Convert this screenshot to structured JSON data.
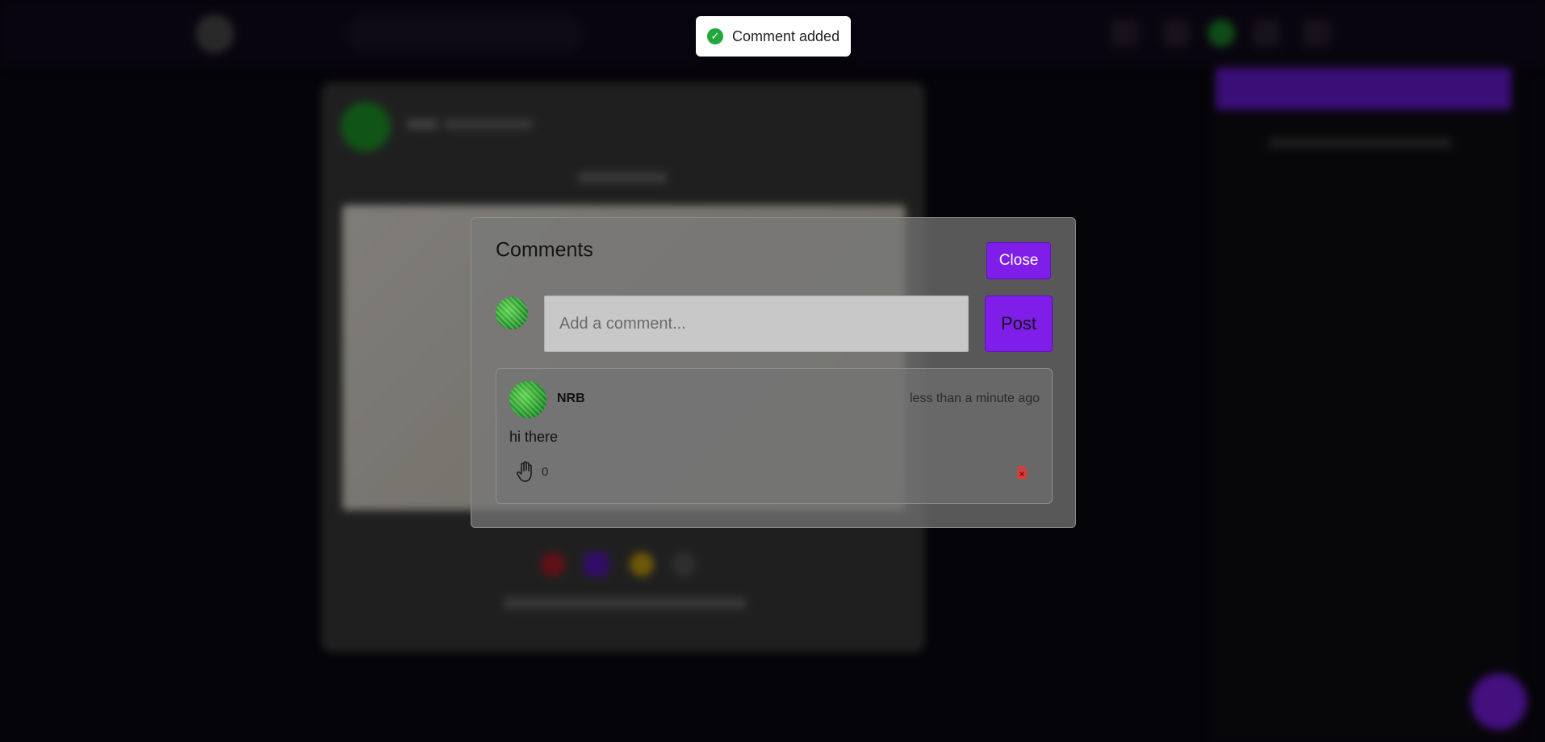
{
  "toast": {
    "icon": "check-circle-icon",
    "message": "Comment added"
  },
  "modal": {
    "title": "Comments",
    "close_label": "Close",
    "input_placeholder": "Add a comment...",
    "post_label": "Post"
  },
  "comments": [
    {
      "author": "NRB",
      "time": "less than a minute ago",
      "text": "hi there",
      "like_icon": "hand-icon",
      "likes": "0",
      "delete_icon": "trash-icon"
    }
  ],
  "colors": {
    "accent": "#7f1ee8",
    "success": "#22a83a",
    "danger": "#e53935"
  }
}
